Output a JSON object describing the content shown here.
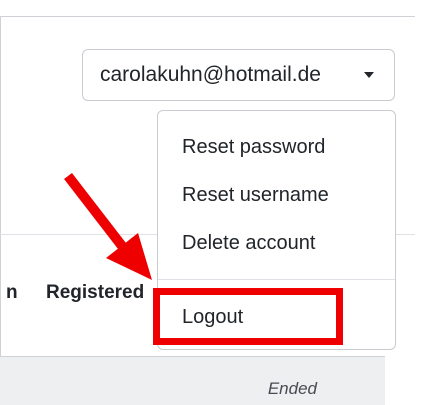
{
  "account": {
    "email": "carolakuhn@hotmail.de"
  },
  "menu": {
    "items": [
      {
        "label": "Reset password"
      },
      {
        "label": "Reset username"
      },
      {
        "label": "Delete account"
      }
    ],
    "logout_label": "Logout"
  },
  "table": {
    "partial_header": "n",
    "registered_header": "Registered",
    "row_status": "Ended"
  },
  "colors": {
    "highlight": "#ee0000",
    "border": "#c8ccd0",
    "row_bg": "#eeeff1"
  },
  "icons": {
    "toggle_caret": "caret-down-icon",
    "annotation_arrow": "arrow-icon"
  }
}
